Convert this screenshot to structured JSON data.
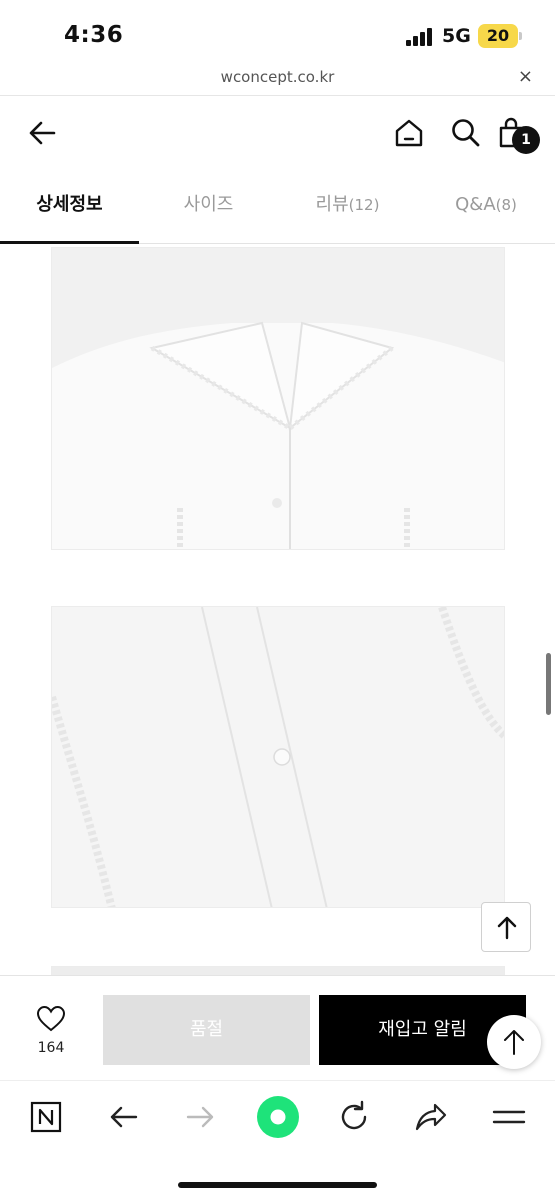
{
  "status_bar": {
    "time": "4:36",
    "network": "5G",
    "battery": "20"
  },
  "url_bar": {
    "url": "wconcept.co.kr",
    "close_label": "×"
  },
  "header": {
    "cart_count": "1"
  },
  "tabs": [
    {
      "label": "상세정보",
      "count": ""
    },
    {
      "label": "사이즈",
      "count": ""
    },
    {
      "label": "리뷰",
      "count": "(12)"
    },
    {
      "label": "Q&A",
      "count": "(8)"
    }
  ],
  "buy_bar": {
    "like_count": "164",
    "soldout_label": "품절",
    "restock_label": "재입고 알림"
  },
  "icons": {
    "back": "back-arrow-icon",
    "home": "home-icon",
    "search": "search-icon",
    "cart": "shopping-bag-icon",
    "heart": "heart-icon",
    "scroll_top": "arrow-up-icon",
    "naver": "naver-n-icon",
    "browser_back": "arrow-left-icon",
    "browser_forward": "arrow-right-icon",
    "green_dot": "green-circle-icon",
    "refresh": "refresh-icon",
    "share": "share-icon",
    "menu": "menu-icon"
  },
  "colors": {
    "accent_green": "#1ee37a",
    "buy_black": "#000000",
    "soldout_gray": "#e0e0e0",
    "battery_yellow": "#f7d84a"
  }
}
